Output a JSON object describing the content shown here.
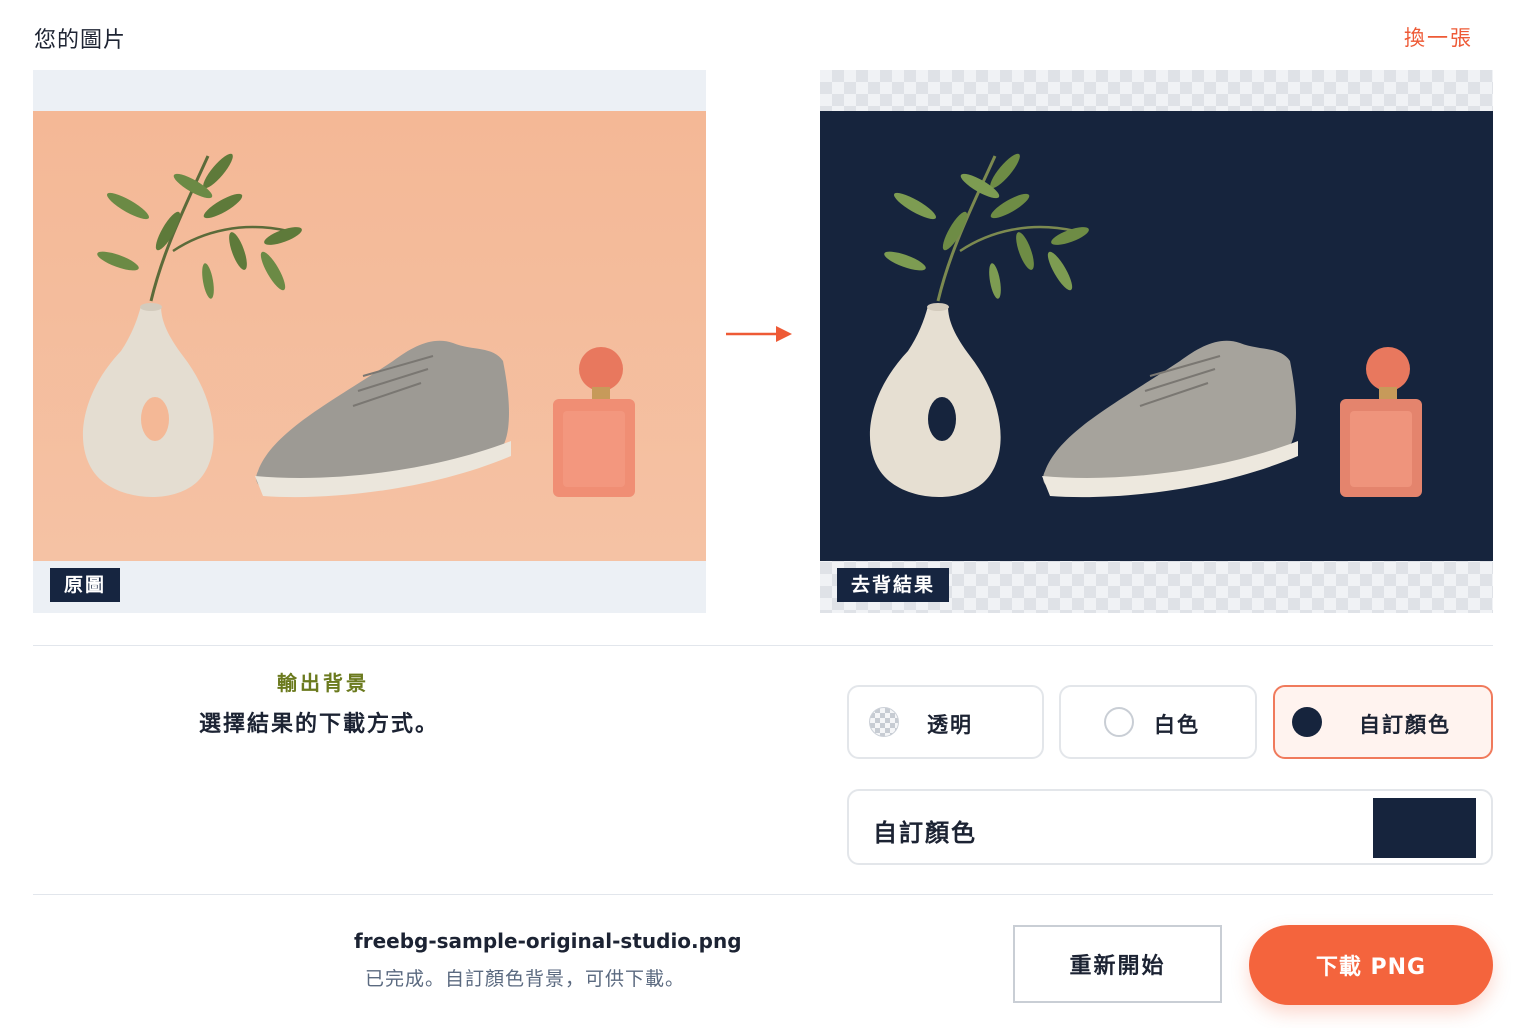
{
  "header": {
    "title": "您的圖片",
    "change_label": "換一張"
  },
  "preview": {
    "original_tag": "原圖",
    "result_tag": "去背結果",
    "result_background_color": "#16243d",
    "original_background_color": "#f4b896"
  },
  "output": {
    "section_label": "輸出背景",
    "description": "選擇結果的下載方式。",
    "options": [
      {
        "label": "透明",
        "icon": "checker-swatch-icon",
        "selected": false
      },
      {
        "label": "白色",
        "icon": "white-swatch-icon",
        "selected": false
      },
      {
        "label": "自訂顏色",
        "icon": "navy-swatch-icon",
        "selected": true
      }
    ],
    "custom_color_label": "自訂顏色",
    "custom_color_value": "#16243d"
  },
  "footer": {
    "filename": "freebg-sample-original-studio.png",
    "status": "已完成。自訂顏色背景，可供下載。",
    "restart_label": "重新開始",
    "download_label": "下載 PNG"
  },
  "colors": {
    "accent": "#f4643d",
    "navy": "#16243d",
    "olive": "#6b7a1e"
  }
}
